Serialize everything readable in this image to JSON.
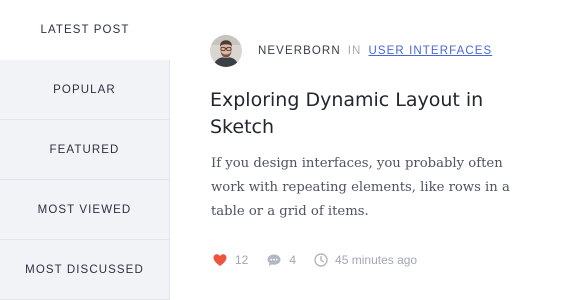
{
  "sidebar": {
    "items": [
      {
        "label": "LATEST POST"
      },
      {
        "label": "POPULAR"
      },
      {
        "label": "FEATURED"
      },
      {
        "label": "MOST VIEWED"
      },
      {
        "label": "MOST DISCUSSED"
      }
    ]
  },
  "post": {
    "author": "NEVERBORN",
    "in_word": "IN",
    "category": "USER INTERFACES",
    "title": "Exploring Dynamic Layout in Sketch",
    "excerpt": "If you design interfaces, you probably often work with repeating elements, like rows in a table or a grid of items.",
    "likes": "12",
    "comments": "4",
    "time": "45 minutes ago"
  },
  "icons": {
    "like": "heart-icon",
    "comments": "speech-bubble-icon",
    "time": "clock-icon"
  },
  "colors": {
    "accent_link": "#4a67d6",
    "heart": "#f0533d",
    "sidebar_bg": "#f2f3f7",
    "title": "#24262f",
    "meta": "#a3a7b4"
  }
}
